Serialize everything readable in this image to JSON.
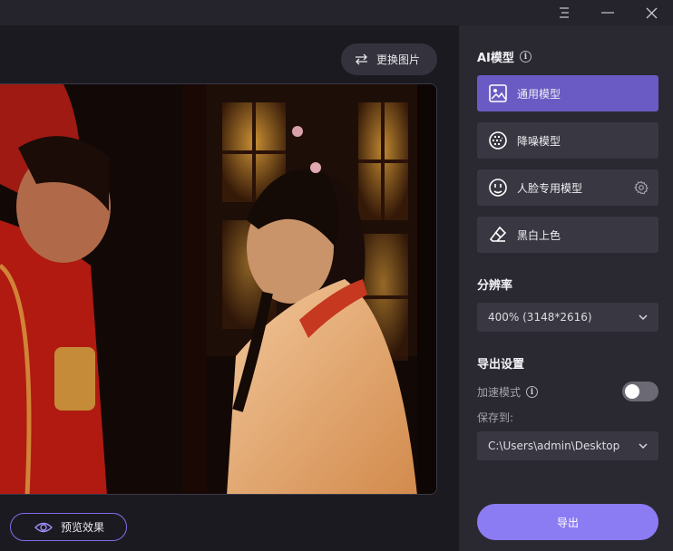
{
  "window": {
    "menu_icon": "menu-icon",
    "minimize_icon": "minimize-icon",
    "close_icon": "close-icon"
  },
  "toolbar": {
    "swap_image_label": "更换图片"
  },
  "preview": {
    "preview_effect_label": "预览效果"
  },
  "panel": {
    "ai_model_title": "AI模型",
    "models": [
      {
        "label": "通用模型",
        "icon": "image-icon",
        "active": true
      },
      {
        "label": "降噪模型",
        "icon": "denoise-icon",
        "active": false
      },
      {
        "label": "人脸专用模型",
        "icon": "face-icon",
        "active": false
      },
      {
        "label": "黑白上色",
        "icon": "eraser-icon",
        "active": false
      }
    ],
    "resolution_title": "分辨率",
    "resolution_value": "400% (3148*2616)",
    "export_settings_title": "导出设置",
    "accelerate_label": "加速模式",
    "accelerate_on": false,
    "save_to_label": "保存到:",
    "save_path": "C:\\Users\\admin\\Desktop",
    "export_label": "导出"
  },
  "colors": {
    "accent": "#8c7cf4",
    "active_model": "#6a5bc4",
    "panel_bg": "#2a2932",
    "canvas_bg": "#1b1a21"
  }
}
